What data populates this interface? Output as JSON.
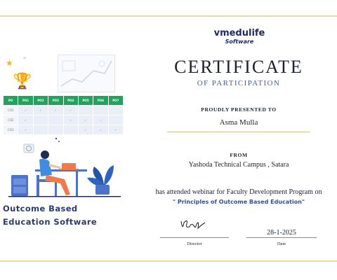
{
  "colors": {
    "border_gold": "#e9d9a8",
    "navy": "#1f2a66",
    "accent_blue": "#3f5ea8",
    "grid_green": "#20a35a",
    "trophy_gold": "#f2b61a"
  },
  "logo": {
    "name": "vmedulife",
    "sub": "Software"
  },
  "certificate": {
    "title": "CERTIFICATE",
    "subtitle": "OF PARTICIPATION",
    "presented_label": "PROUDLY PRESENTED TO",
    "recipient": "Asma Mulla",
    "from_label": "FROM",
    "institution": "Yashoda Technical Campus , Satara",
    "statement": "has attended webinar for Faculty Development Program on",
    "program": "\" Principles of Outcome Based Education\"",
    "date": "28-1-2025",
    "director_label": "Director",
    "date_label": "Date"
  },
  "illustration": {
    "grid_headers": [
      "PO",
      "PO1",
      "PO2",
      "PO3",
      "PO4",
      "PO5",
      "PO6",
      "PO7"
    ],
    "grid_rows": [
      {
        "label": "CO1",
        "cells": [
          "✓",
          "✓",
          "✓",
          "✓",
          "",
          "",
          ""
        ]
      },
      {
        "label": "CO2",
        "cells": [
          "✓",
          "",
          "",
          "✓",
          "✓",
          "✓",
          ""
        ]
      },
      {
        "label": "CO3",
        "cells": [
          "✓",
          "",
          "",
          "",
          "✓",
          "✓",
          "✓"
        ]
      }
    ],
    "tagline_1": "Outcome Based",
    "tagline_2": "Education Software",
    "icons": [
      "trophy-icon",
      "star-icon",
      "chart-icon",
      "person-at-desk-icon",
      "laptop-icon",
      "plant-icon",
      "clock-icon"
    ]
  }
}
